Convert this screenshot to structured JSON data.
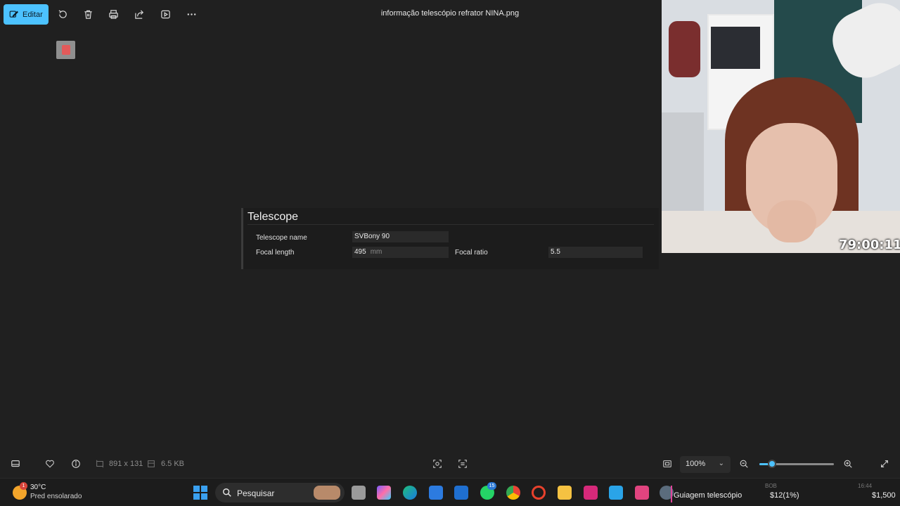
{
  "toolbar": {
    "edit_label": "Editar",
    "file_title": "informação telescópio refrator NINA.png",
    "icons": [
      "edit-icon",
      "rotate-icon",
      "delete-icon",
      "print-icon",
      "share-icon",
      "slideshow-icon",
      "more-icon"
    ]
  },
  "image_content": {
    "section_title": "Telescope",
    "fields": {
      "telescope_name_label": "Telescope name",
      "telescope_name_value": "SVBony 90",
      "focal_length_label": "Focal length",
      "focal_length_value": "495",
      "focal_length_unit": "mm",
      "focal_ratio_label": "Focal ratio",
      "focal_ratio_value": "5.5"
    }
  },
  "webcam": {
    "timer": "79:00:11"
  },
  "statusbar": {
    "dimensions": "891 x 131",
    "file_size": "6.5 KB",
    "zoom": "100%",
    "zoom_slider_level_percent": 12
  },
  "taskbar": {
    "weather_temp": "30°C",
    "weather_desc": "Pred ensolarado",
    "weather_badge": "1",
    "search_placeholder": "Pesquisar",
    "whatsapp_badge": "15",
    "widget_label": "Guiagem telescópio",
    "widget_value1": "$12(1%)",
    "widget_value2": "$1,500",
    "faint_top1": "BOB",
    "faint_top2": "16:44"
  },
  "colors": {
    "accent": "#4cc2ff",
    "background": "#202020"
  }
}
